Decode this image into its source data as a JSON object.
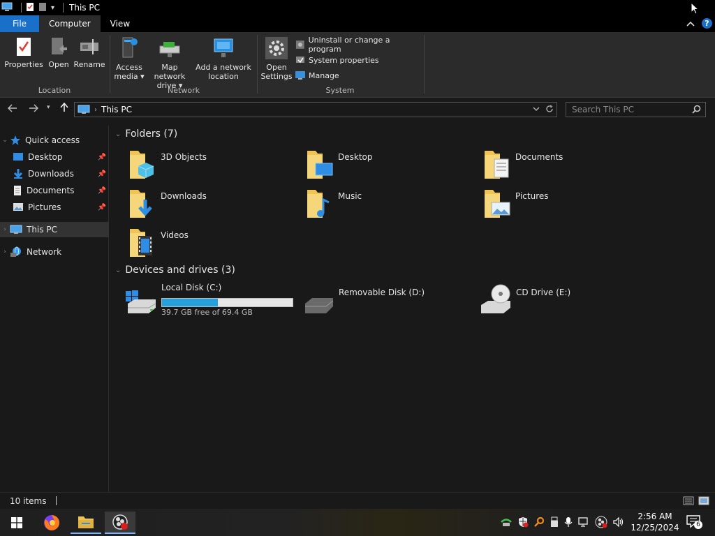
{
  "window": {
    "title": "This PC"
  },
  "tabs": {
    "file": "File",
    "computer": "Computer",
    "view": "View"
  },
  "ribbon": {
    "location": {
      "label": "Location",
      "properties": "Properties",
      "open": "Open",
      "rename": "Rename"
    },
    "network": {
      "label": "Network",
      "access_media_1": "Access",
      "access_media_2": "media ▾",
      "map_drive_1": "Map network",
      "map_drive_2": "drive ▾",
      "add_location_1": "Add a network",
      "add_location_2": "location"
    },
    "system": {
      "label": "System",
      "open_settings_1": "Open",
      "open_settings_2": "Settings",
      "uninstall": "Uninstall or change a program",
      "system_properties": "System properties",
      "manage": "Manage"
    }
  },
  "address": {
    "path": "This PC",
    "search_placeholder": "Search This PC"
  },
  "nav": {
    "quick_access": "Quick access",
    "desktop": "Desktop",
    "downloads": "Downloads",
    "documents": "Documents",
    "pictures": "Pictures",
    "this_pc": "This PC",
    "network": "Network"
  },
  "content": {
    "folders_header": "Folders (7)",
    "folders": [
      "3D Objects",
      "Desktop",
      "Documents",
      "Downloads",
      "Music",
      "Pictures",
      "Videos"
    ],
    "devices_header": "Devices and drives (3)",
    "drives": {
      "c_name": "Local Disk (C:)",
      "c_free": "39.7 GB free of 69.4 GB",
      "c_used_fraction": 0.428,
      "d_name": "Removable Disk (D:)",
      "e_name": "CD Drive (E:)"
    }
  },
  "status": {
    "count": "10 items"
  },
  "taskbar": {
    "time": "2:56 AM",
    "date": "12/25/2024",
    "notifications": "6"
  },
  "colors": {
    "accent": "#1a6fc9",
    "folder": "#f0c454",
    "progress": "#26a0da"
  }
}
